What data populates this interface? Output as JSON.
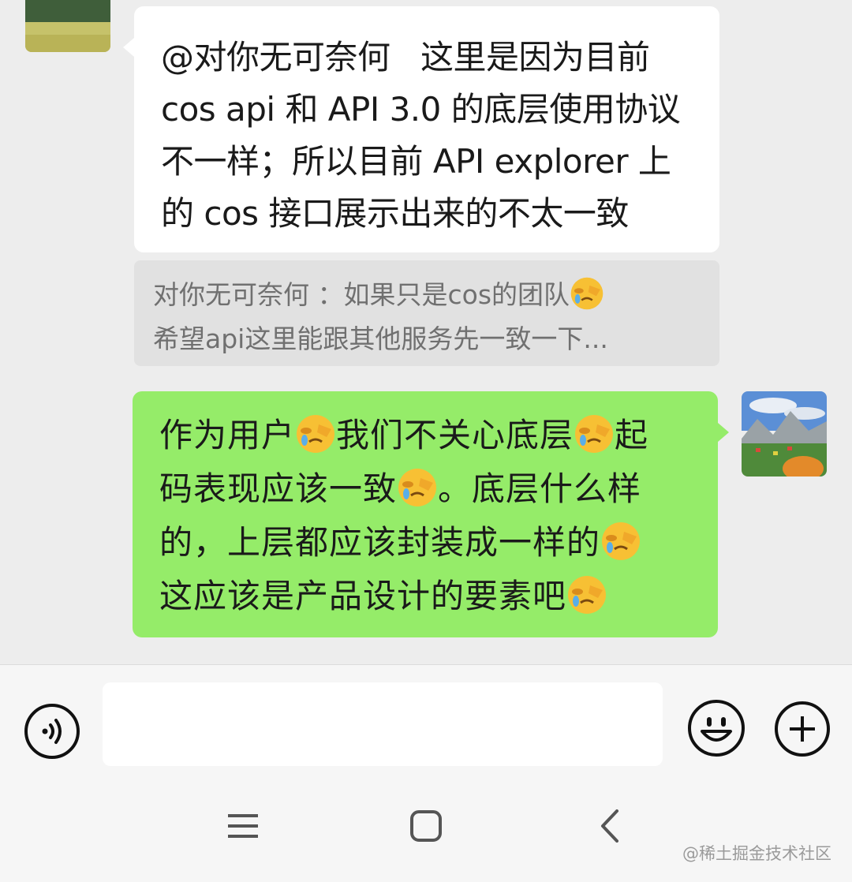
{
  "chat": {
    "incoming": {
      "text": "@对你无可奈何   这里是因为目前\ncos api 和 API 3.0 的底层使用协议\n不一样；所以目前 API explorer 上\n的 cos 接口展示出来的不太一致"
    },
    "quote": {
      "line1": "对你无可奈何 ：如果只是cos的团队",
      "line2": "希望api这里能跟其他服务先一致一下..."
    },
    "outgoing": {
      "seg1": "作为用户",
      "seg2": "我们不关心底层",
      "seg3": "起\n码表现应该一致",
      "seg4": "。底层什么样\n的，上层都应该封装成一样的",
      "seg5": "\n这应该是产品设计的要素吧",
      "emoji_icon": "face-palm-crying-emoji"
    }
  },
  "input_bar": {
    "message_value": "",
    "icons": [
      "voice-icon",
      "emoji-icon",
      "plus-icon"
    ]
  },
  "nav_bar": {
    "icons": [
      "menu-icon",
      "home-icon",
      "back-icon"
    ]
  },
  "watermark": "@稀土掘金技术社区",
  "colors": {
    "background": "#ededed",
    "incoming_bubble": "#ffffff",
    "outgoing_bubble": "#95ec69",
    "quote_background": "#e1e1e1",
    "bar_background": "#f6f6f6"
  }
}
